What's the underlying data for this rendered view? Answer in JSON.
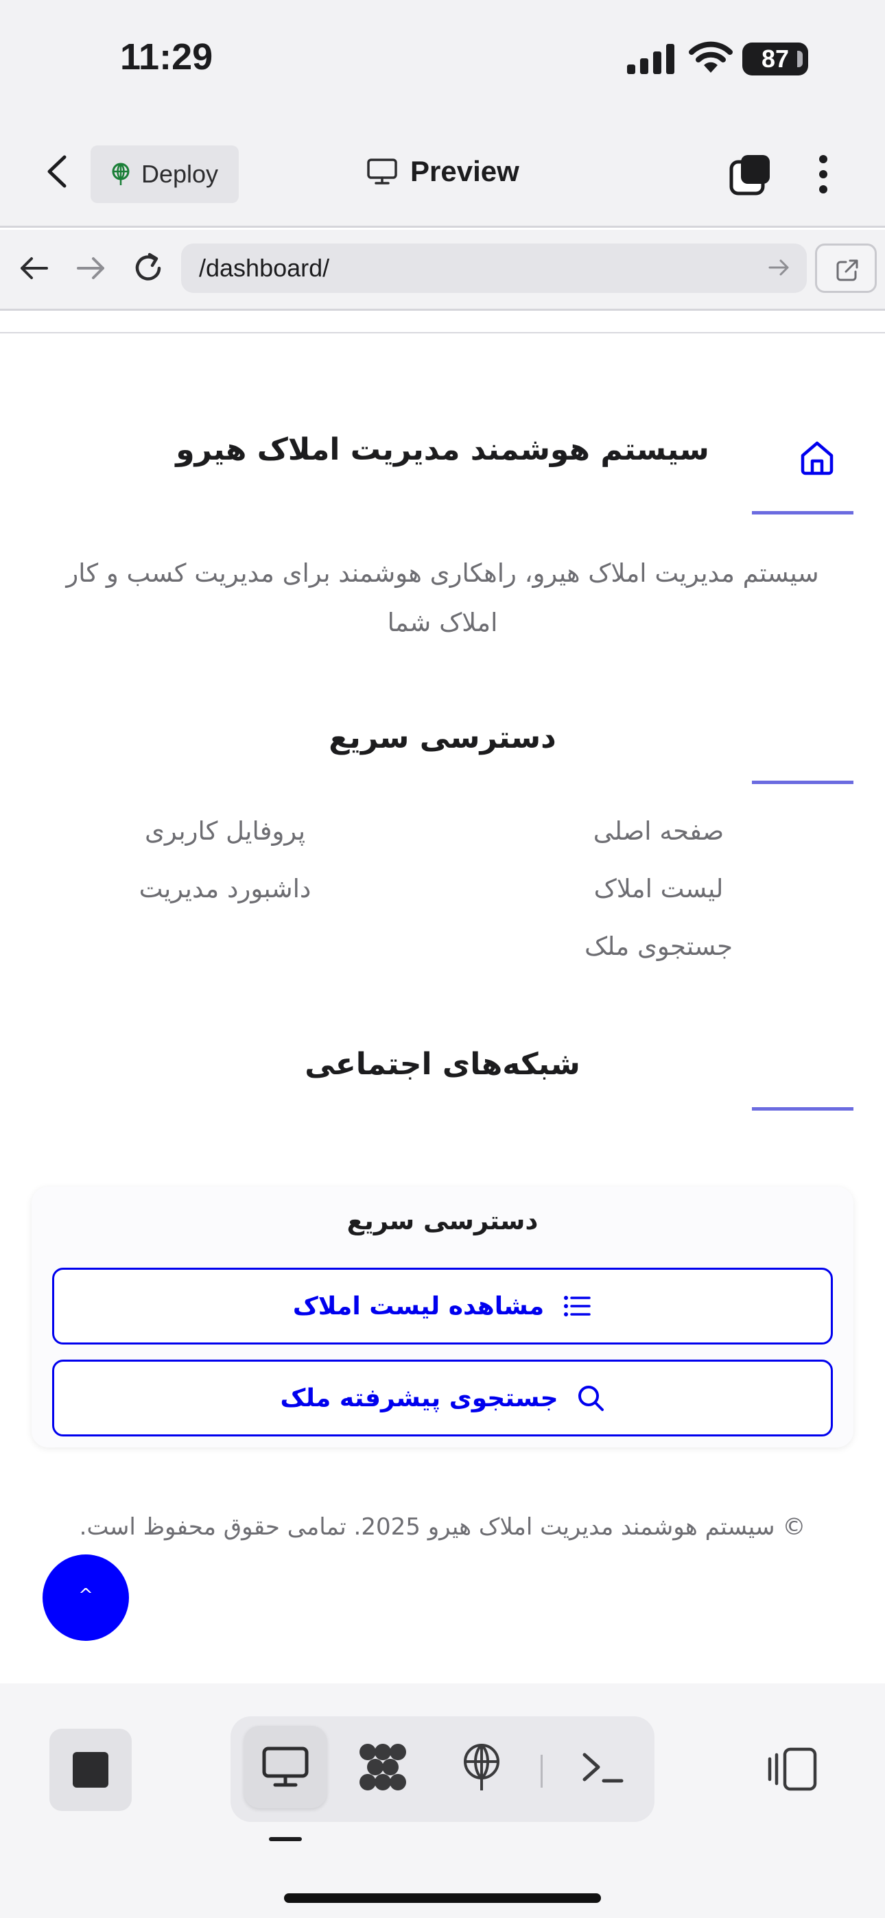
{
  "status": {
    "time": "11:29",
    "battery": "87"
  },
  "appbar": {
    "deploy_label": "Deploy",
    "preview_label": "Preview"
  },
  "browser": {
    "url": "/dashboard/"
  },
  "page": {
    "title": "سیستم هوشمند مدیریت املاک هیرو",
    "intro": "سیستم مدیریت املاک هیرو، راهکاری هوشمند برای مدیریت کسب و کار املاک شما",
    "quick_access_heading": "دسترسی سریع",
    "links": [
      "صفحه اصلی",
      "پروفایل کاربری",
      "لیست املاک",
      "داشبورد مدیریت",
      "جستجوی ملک"
    ],
    "social_heading": "شبکه‌های اجتماعی",
    "card": {
      "title": "دسترسی سریع",
      "view_list_label": "مشاهده لیست املاک",
      "advanced_search_label": "جستجوی پیشرفته ملک"
    },
    "footer": "© سیستم هوشمند مدیریت املاک هیرو 2025. تمامی حقوق محفوظ است.",
    "scroll_top_glyph": "^"
  },
  "colors": {
    "accent": "#0000ff",
    "line": "#6b6be0",
    "muted": "#6d6d72"
  },
  "icons": [
    "back-icon",
    "deploy-icon",
    "monitor-icon",
    "tabs-icon",
    "more-icon",
    "arrow-left-icon",
    "arrow-right-icon",
    "reload-icon",
    "external-link-icon",
    "home-icon",
    "list-icon",
    "search-icon",
    "stop-icon",
    "network-icon",
    "globe-icon",
    "terminal-icon",
    "panel-icon"
  ]
}
